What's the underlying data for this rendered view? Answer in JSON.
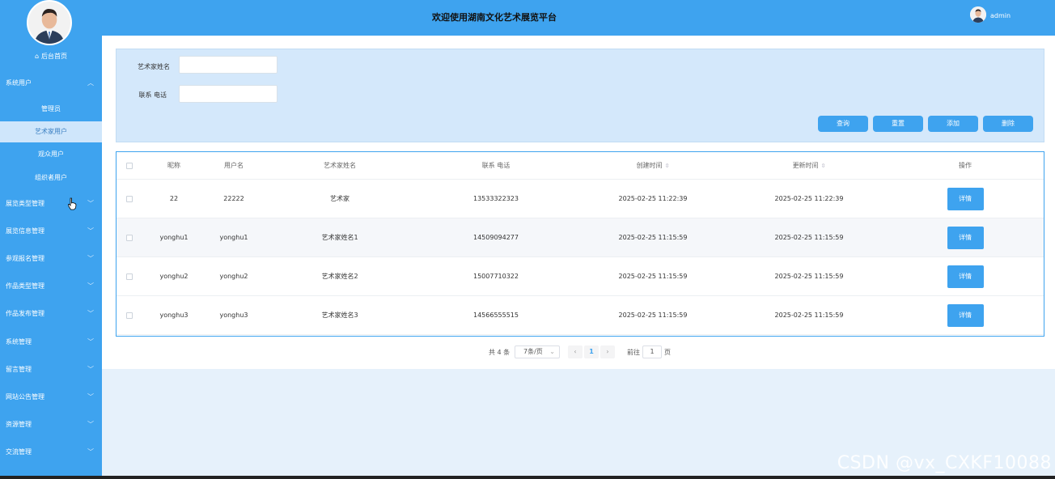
{
  "header": {
    "title": "欢迎使用湖南文化艺术展览平台",
    "username": "admin"
  },
  "sidebar": {
    "home_label": "后台首页",
    "groups": [
      {
        "label": "系统用户",
        "expanded": true
      },
      {
        "label": "展览类型管理"
      },
      {
        "label": "展览信息管理"
      },
      {
        "label": "参观报名管理"
      },
      {
        "label": "作品类型管理"
      },
      {
        "label": "作品发布管理"
      },
      {
        "label": "系统管理"
      },
      {
        "label": "留言管理"
      },
      {
        "label": "网站公告管理"
      },
      {
        "label": "资源管理"
      },
      {
        "label": "交流管理"
      }
    ],
    "sub_items": [
      {
        "label": "管理员",
        "active": false
      },
      {
        "label": "艺术家用户",
        "active": true
      },
      {
        "label": "观众用户",
        "active": false
      },
      {
        "label": "组织者用户",
        "active": false
      }
    ]
  },
  "search": {
    "name_label": "艺术家姓名",
    "name_value": "",
    "phone_label": "联系 电话",
    "phone_value": ""
  },
  "actions": {
    "query": "查询",
    "reset": "重置",
    "add": "添加",
    "delete": "删除"
  },
  "table": {
    "columns": [
      "昵称",
      "用户名",
      "艺术家姓名",
      "联系 电话",
      "创建时间",
      "更新时间",
      "操作"
    ],
    "rows": [
      {
        "nickname": "22",
        "username": "22222",
        "artist_name": "艺术家",
        "phone": "13533322323",
        "created": "2025-02-25 11:22:39",
        "updated": "2025-02-25 11:22:39",
        "action": "详情"
      },
      {
        "nickname": "yonghu1",
        "username": "yonghu1",
        "artist_name": "艺术家姓名1",
        "phone": "14509094277",
        "created": "2025-02-25 11:15:59",
        "updated": "2025-02-25 11:15:59",
        "action": "详情"
      },
      {
        "nickname": "yonghu2",
        "username": "yonghu2",
        "artist_name": "艺术家姓名2",
        "phone": "15007710322",
        "created": "2025-02-25 11:15:59",
        "updated": "2025-02-25 11:15:59",
        "action": "详情"
      },
      {
        "nickname": "yonghu3",
        "username": "yonghu3",
        "artist_name": "艺术家姓名3",
        "phone": "14566555515",
        "created": "2025-02-25 11:15:59",
        "updated": "2025-02-25 11:15:59",
        "action": "详情"
      }
    ]
  },
  "pagination": {
    "total": "共 4 条",
    "page_size": "7条/页",
    "prev": "‹",
    "current_page": "1",
    "next": "›",
    "goto_label": "前往",
    "goto_value": "1",
    "page_suffix": "页"
  },
  "watermark": "CSDN @vx_CXKF10088",
  "colors": {
    "primary": "#3ea3ef",
    "active_bg": "#cfe6fb",
    "panel_bg": "#d4e8fb"
  }
}
